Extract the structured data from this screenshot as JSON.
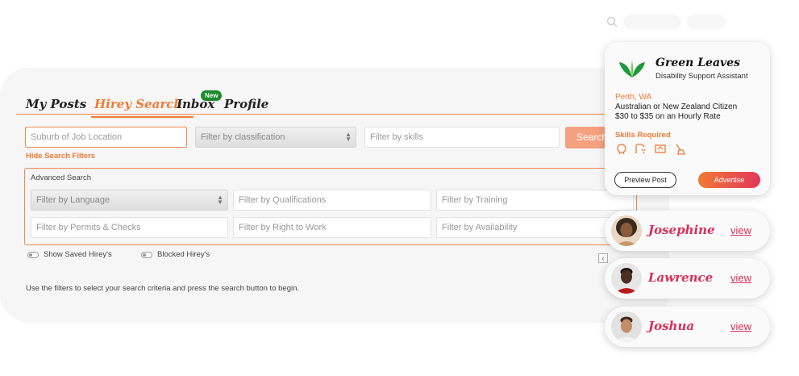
{
  "tabs": [
    "My Posts",
    "Hirey Search",
    "Inbox",
    "Profile"
  ],
  "inbox_badge": "New",
  "filters": {
    "suburb_placeholder": "Suburb of Job Location",
    "classification": "Filter by classification",
    "skills_placeholder": "Filter by skills",
    "search_label": "Search",
    "hide_filters": "Hide Search Filters"
  },
  "advanced": {
    "title": "Advanced Search",
    "language": "Filter by Language",
    "qualifications": "Filter by Qualifications",
    "training": "Filter by Training",
    "permits": "Filter by Permits & Checks",
    "right_to_work": "Filter by Right to Work",
    "availability": "Filter by Availability"
  },
  "toggles": {
    "saved": "Show Saved Hirey's",
    "blocked": "Blocked Hirey's"
  },
  "help_text": "Use the filters to select your search criteria and press the search button to begin.",
  "job": {
    "company": "Green Leaves",
    "role": "Disability Support Assistant",
    "location": "Perth, WA",
    "citizenship": "Australian or New Zealand Citizen",
    "rate": "$30 to $35 on an Hourly Rate",
    "skills_title": "Skills Required",
    "preview": "Preview Post",
    "advertise": "Advertise",
    "accent": "#f07a34"
  },
  "candidates": [
    {
      "name": "Josephine",
      "view": "view"
    },
    {
      "name": "Lawrence",
      "view": "view"
    },
    {
      "name": "Joshua",
      "view": "view"
    }
  ]
}
